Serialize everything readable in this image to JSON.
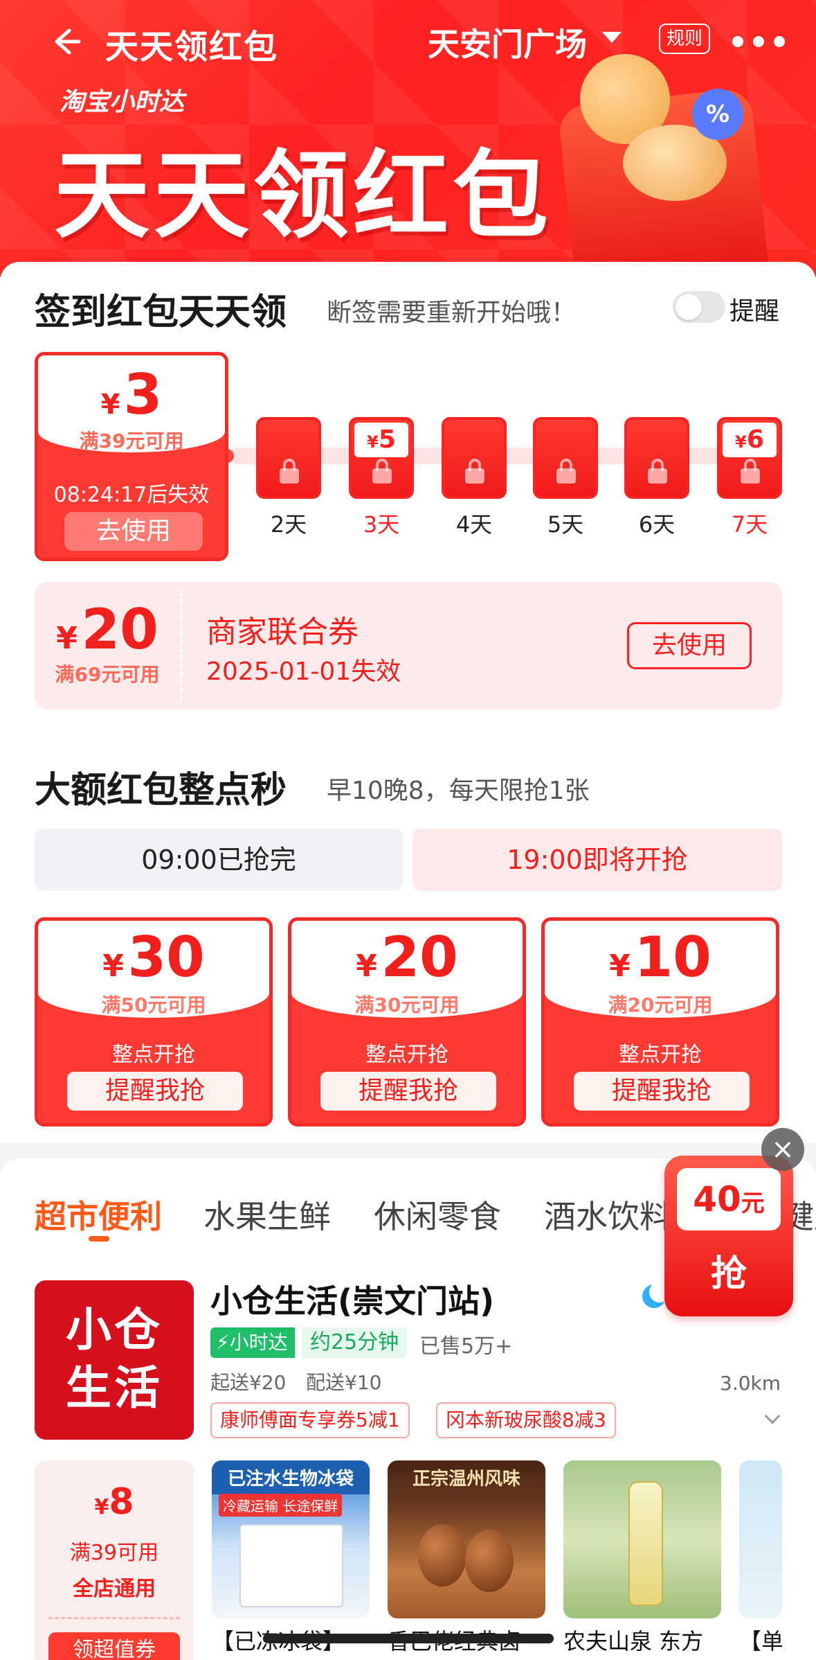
{
  "nav": {
    "title": "天天领红包",
    "location": "天安门广场",
    "rules": "规则"
  },
  "hero": {
    "brand": "淘宝小时达",
    "title": "天天领红包",
    "badge": "%"
  },
  "signin": {
    "title": "签到红包天天领",
    "subtitle": "断签需要重新开始哦！",
    "remind_label": "提醒",
    "remind_on": false,
    "day1": {
      "currency": "¥",
      "amount": "3",
      "condition": "满39元可用",
      "timer": "08:24:17后失效",
      "use_label": "去使用"
    },
    "days": [
      {
        "label": "2天",
        "value": null,
        "highlight": false
      },
      {
        "label": "3天",
        "value": "5",
        "highlight": true
      },
      {
        "label": "4天",
        "value": null,
        "highlight": false
      },
      {
        "label": "5天",
        "value": null,
        "highlight": false
      },
      {
        "label": "6天",
        "value": null,
        "highlight": false
      },
      {
        "label": "7天",
        "value": "6",
        "highlight": true
      }
    ],
    "day_currency": "¥"
  },
  "merchant_coupon": {
    "currency": "¥",
    "amount": "20",
    "condition": "满69元可用",
    "name": "商家联合券",
    "expiry": "2025-01-01失效",
    "use_label": "去使用"
  },
  "flash": {
    "title": "大额红包整点秒",
    "subtitle": "早10晚8，每天限抢1张",
    "slot_done": "09:00已抢完",
    "slot_next": "19:00即将开抢",
    "coupons": [
      {
        "currency": "¥",
        "amount": "30",
        "condition": "满50元可用",
        "status": "整点开抢",
        "button": "提醒我抢"
      },
      {
        "currency": "¥",
        "amount": "20",
        "condition": "满30元可用",
        "status": "整点开抢",
        "button": "提醒我抢"
      },
      {
        "currency": "¥",
        "amount": "10",
        "condition": "满20元可用",
        "status": "整点开抢",
        "button": "提醒我抢"
      }
    ]
  },
  "tabs": [
    "超市便利",
    "水果生鲜",
    "休闲零食",
    "酒水饮料",
    "健康"
  ],
  "floating": {
    "close": "×",
    "amount": "40",
    "unit": "元",
    "grab": "抢"
  },
  "store": {
    "logo_line1": "小仓",
    "logo_line2": "生活",
    "name": "小仓生活(崇文门站)",
    "fast_badge": "⚡小时达",
    "eta": "约25分钟",
    "sold": "已售5万+",
    "min_order": "起送¥20",
    "delivery_fee": "配送¥10",
    "distance": "3.0km",
    "promos": [
      "康师傅面专享券5减1",
      "冈本新玻尿酸8减3"
    ],
    "coupon": {
      "currency": "¥",
      "amount": "8",
      "condition": "满39可用",
      "scope": "全店通用",
      "button": "领超值券"
    },
    "products": [
      {
        "title": "【已冻冰袋】",
        "band": "已注水生物冰袋",
        "caption": "冷藏运输 长途保鲜"
      },
      {
        "title": "香巴佬经典卤",
        "band": "正宗温州风味",
        "caption": ""
      },
      {
        "title": "农夫山泉 东方",
        "band": "",
        "caption": ""
      },
      {
        "title": "【单",
        "band": "",
        "caption": ""
      }
    ]
  },
  "colors": {
    "primary_red": "#f2201c",
    "tab_active": "#ff5a1a",
    "fast_green": "#1fbf6a"
  }
}
